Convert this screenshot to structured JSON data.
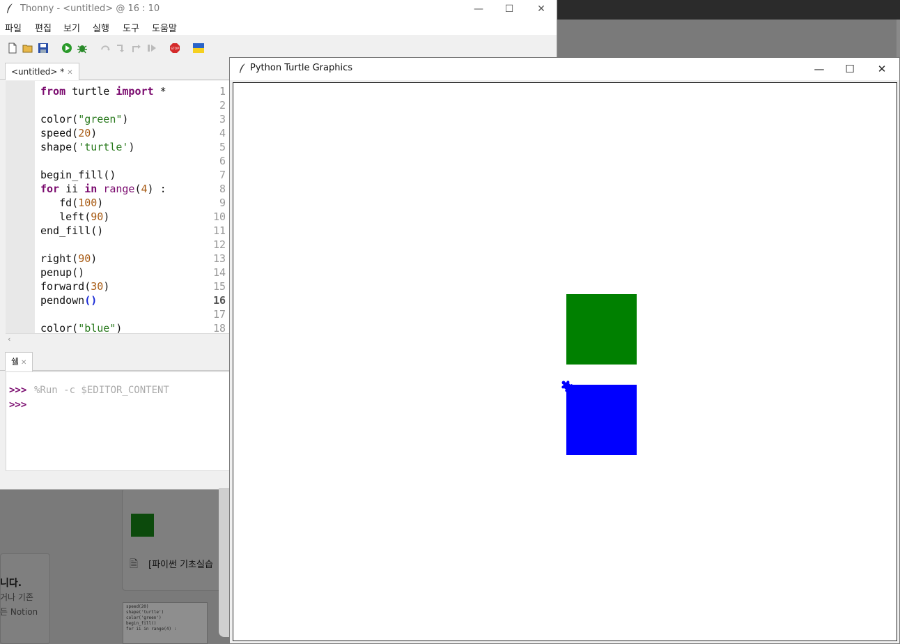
{
  "background": {
    "doc_title": "[파이썬 기초실습",
    "left_bold": "니다.",
    "left_line1": "거나 기존",
    "left_line2": "든 Notion",
    "code_thumb": [
      "speed(20)",
      "shape('turtle')",
      "color('green')",
      "",
      "begin_fill()",
      "for ii in range(4) :"
    ]
  },
  "thonny": {
    "title": "Thonny  -  <untitled>  @  16 : 10",
    "menu": [
      "파일",
      "편집",
      "보기",
      "실행",
      "도구",
      "도움말"
    ],
    "tab_label": "<untitled>  *",
    "shell_tab_label": "쉘",
    "editor_lines": [
      {
        "n": "1",
        "segs": [
          [
            "kw",
            "from"
          ],
          [
            "",
            "  turtle "
          ],
          [
            "kw",
            "import"
          ],
          [
            "",
            " *"
          ]
        ]
      },
      {
        "n": "2",
        "segs": []
      },
      {
        "n": "3",
        "segs": [
          [
            "",
            "color("
          ],
          [
            "str",
            "\"green\""
          ],
          [
            "",
            ")"
          ]
        ]
      },
      {
        "n": "4",
        "segs": [
          [
            "",
            "speed("
          ],
          [
            "num",
            "20"
          ],
          [
            "",
            ")"
          ]
        ]
      },
      {
        "n": "5",
        "segs": [
          [
            "",
            "shape("
          ],
          [
            "str",
            "'turtle'"
          ],
          [
            "",
            ")"
          ]
        ]
      },
      {
        "n": "6",
        "segs": []
      },
      {
        "n": "7",
        "segs": [
          [
            "",
            "begin_fill()"
          ]
        ]
      },
      {
        "n": "8",
        "segs": [
          [
            "kw",
            "for"
          ],
          [
            "",
            " ii "
          ],
          [
            "kw",
            "in"
          ],
          [
            "",
            " "
          ],
          [
            "bi",
            "range"
          ],
          [
            "",
            "("
          ],
          [
            "num",
            "4"
          ],
          [
            "",
            ") :"
          ]
        ]
      },
      {
        "n": "9",
        "segs": [
          [
            "",
            "    fd("
          ],
          [
            "num",
            "100"
          ],
          [
            "",
            ")"
          ]
        ]
      },
      {
        "n": "10",
        "segs": [
          [
            "",
            "    left("
          ],
          [
            "num",
            "90"
          ],
          [
            "",
            ")"
          ]
        ]
      },
      {
        "n": "11",
        "segs": [
          [
            "",
            "end_fill()"
          ]
        ]
      },
      {
        "n": "12",
        "segs": []
      },
      {
        "n": "13",
        "segs": [
          [
            "",
            "right("
          ],
          [
            "num",
            "90"
          ],
          [
            "",
            ")"
          ]
        ]
      },
      {
        "n": "14",
        "segs": [
          [
            "",
            "penup()"
          ]
        ]
      },
      {
        "n": "15",
        "segs": [
          [
            "",
            "forward("
          ],
          [
            "num",
            "30"
          ],
          [
            "",
            ")"
          ]
        ]
      },
      {
        "n": "16",
        "segs": [
          [
            "",
            "pendown"
          ],
          [
            "par",
            "()"
          ]
        ]
      },
      {
        "n": "17",
        "segs": []
      },
      {
        "n": "18",
        "segs": [
          [
            "",
            "color("
          ],
          [
            "str",
            "\"blue\""
          ],
          [
            "",
            ")"
          ]
        ]
      }
    ],
    "current_line": "16",
    "shell": {
      "prompt": ">>>",
      "command": "%Run -c $EDITOR_CONTENT"
    }
  },
  "turtle_window": {
    "title": "Python Turtle Graphics",
    "fill_colors": [
      "#008000",
      "#0000ff"
    ]
  }
}
